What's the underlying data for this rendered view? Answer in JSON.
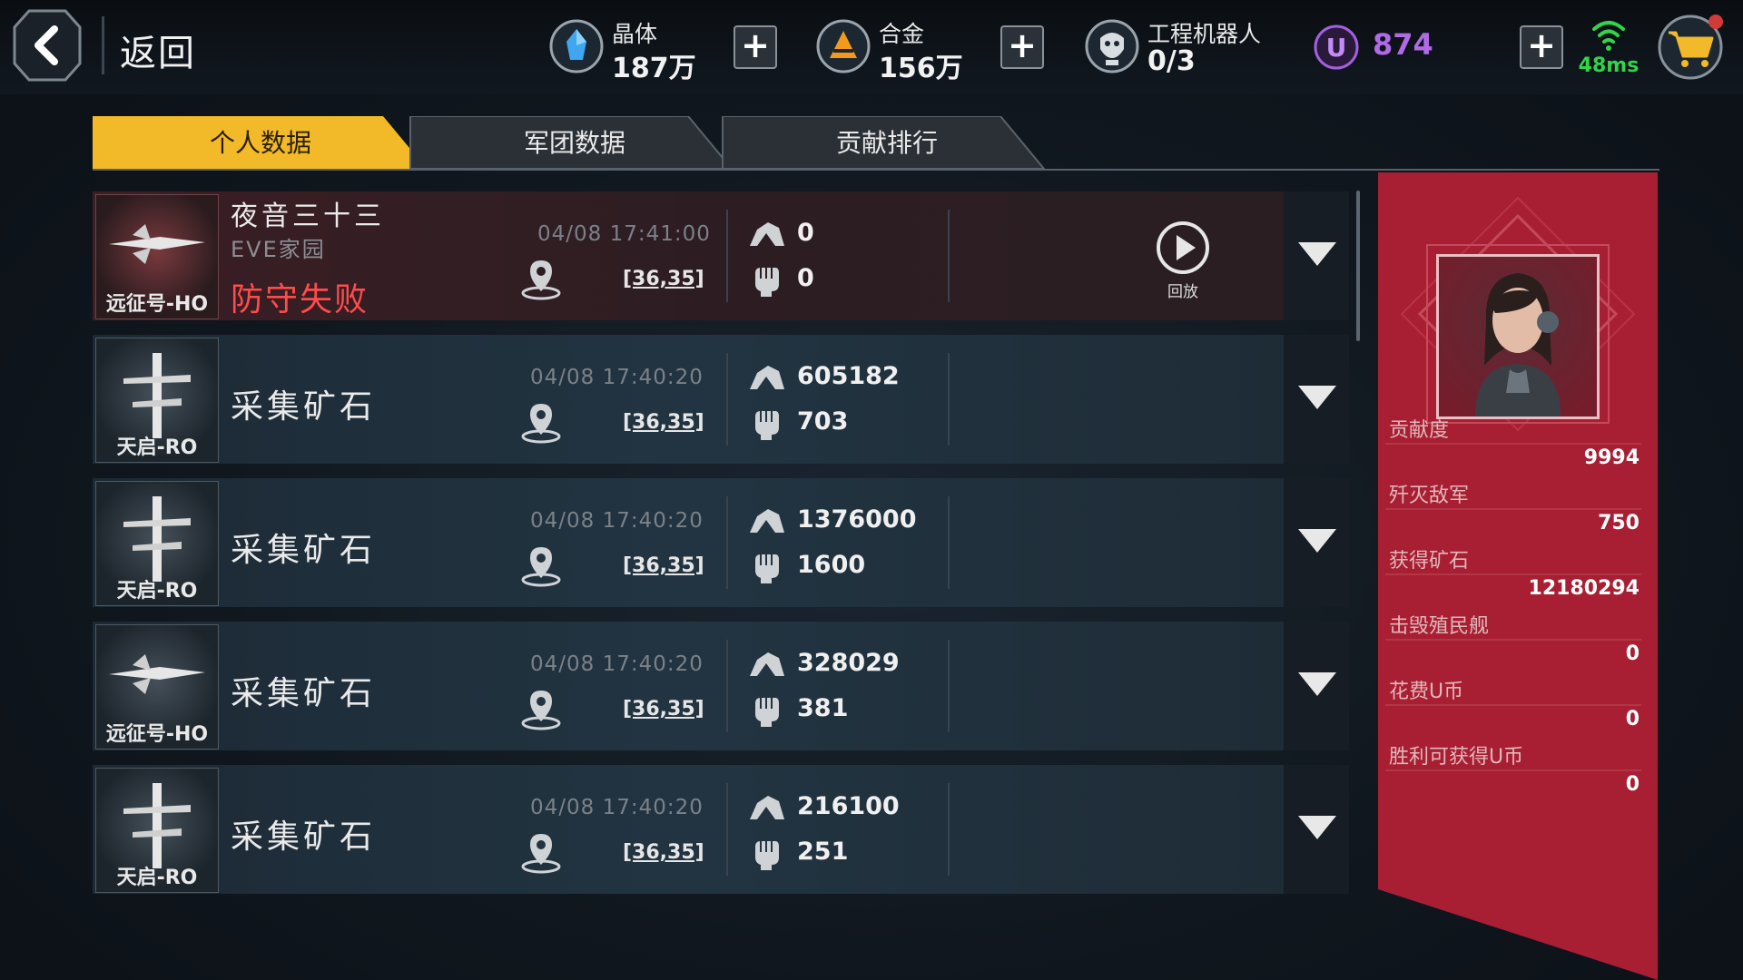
{
  "topbar": {
    "back_label": "返回",
    "crystal": {
      "label": "晶体",
      "value": "187万"
    },
    "alloy": {
      "label": "合金",
      "value": "156万"
    },
    "robot": {
      "label": "工程机器人",
      "value": "0/3"
    },
    "ucoin": {
      "value": "874"
    },
    "plus_symbol": "+",
    "ping": "48ms"
  },
  "tabs": [
    {
      "label": "个人数据",
      "active": true
    },
    {
      "label": "军团数据",
      "active": false
    },
    {
      "label": "贡献排行",
      "active": false
    }
  ],
  "rows": [
    {
      "ship": "远征号-HO",
      "title": "夜音三十三",
      "subtitle": "EVE家园",
      "status": "防守失败",
      "time": "04/08 17:41:00",
      "coord": "[36,35]",
      "ore": "0",
      "kills": "0",
      "replay_label": "回放"
    },
    {
      "ship": "天启-RO",
      "title": "采集矿石",
      "time": "04/08 17:40:20",
      "coord": "[36,35]",
      "ore": "605182",
      "kills": "703"
    },
    {
      "ship": "天启-RO",
      "title": "采集矿石",
      "time": "04/08 17:40:20",
      "coord": "[36,35]",
      "ore": "1376000",
      "kills": "1600"
    },
    {
      "ship": "远征号-HO",
      "title": "采集矿石",
      "time": "04/08 17:40:20",
      "coord": "[36,35]",
      "ore": "328029",
      "kills": "381"
    },
    {
      "ship": "天启-RO",
      "title": "采集矿石",
      "time": "04/08 17:40:20",
      "coord": "[36,35]",
      "ore": "216100",
      "kills": "251"
    }
  ],
  "stats": [
    {
      "label": "贡献度",
      "value": "9994"
    },
    {
      "label": "歼灭敌军",
      "value": "750"
    },
    {
      "label": "获得矿石",
      "value": "12180294"
    },
    {
      "label": "击毁殖民舰",
      "value": "0"
    },
    {
      "label": "花费U币",
      "value": "0"
    },
    {
      "label": "胜利可获得U币",
      "value": "0"
    }
  ],
  "colors": {
    "tab_active": "#f2b928",
    "panel_red": "#a81e32",
    "defense_fail": "#ff4b4b",
    "ucoin": "#b06ae6",
    "ping": "#32d44a"
  },
  "icons": [
    "back-arrow-icon",
    "crystal-icon",
    "alloy-icon",
    "robot-icon",
    "ucoin-icon",
    "wifi-icon",
    "cart-icon",
    "map-pin-icon",
    "ore-icon",
    "fist-icon",
    "play-icon",
    "chevron-down-icon"
  ]
}
